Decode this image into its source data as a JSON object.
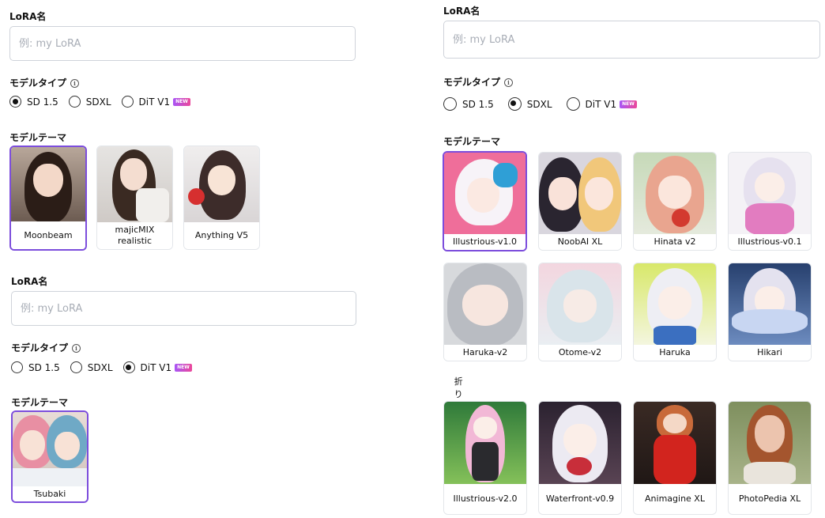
{
  "colors": {
    "accent": "#7c4ddc",
    "new_badge": "#c026d3"
  },
  "panels": [
    {
      "lora_label": "LoRA名",
      "placeholder": "例: my LoRA",
      "type_label": "モデルタイプ",
      "radios": [
        {
          "label": "SD 1.5",
          "selected": true,
          "new": false
        },
        {
          "label": "SDXL",
          "selected": false,
          "new": false
        },
        {
          "label": "DiT V1",
          "selected": false,
          "new": true
        }
      ],
      "theme_label": "モデルテーマ",
      "themes": [
        {
          "name": "Moonbeam",
          "selected": true
        },
        {
          "name": "majicMIX realistic",
          "selected": false
        },
        {
          "name": "Anything V5",
          "selected": false
        }
      ]
    },
    {
      "lora_label": "LoRA名",
      "placeholder": "例: my LoRA",
      "type_label": "モデルタイプ",
      "radios": [
        {
          "label": "SD 1.5",
          "selected": false,
          "new": false
        },
        {
          "label": "SDXL",
          "selected": false,
          "new": false
        },
        {
          "label": "DiT V1",
          "selected": true,
          "new": true
        }
      ],
      "theme_label": "モデルテーマ",
      "themes": [
        {
          "name": "Tsubaki",
          "selected": true
        }
      ]
    },
    {
      "lora_label": "LoRA名",
      "placeholder": "例: my LoRA",
      "type_label": "モデルタイプ",
      "radios": [
        {
          "label": "SD 1.5",
          "selected": false,
          "new": false
        },
        {
          "label": "SDXL",
          "selected": true,
          "new": false
        },
        {
          "label": "DiT V1",
          "selected": false,
          "new": true
        }
      ],
      "theme_label": "モデルテーマ",
      "themes": [
        {
          "name": "Illustrious-v1.0",
          "selected": true
        },
        {
          "name": "NoobAI XL",
          "selected": false
        },
        {
          "name": "Hinata v2",
          "selected": false
        },
        {
          "name": "Illustrious-v0.1",
          "selected": false
        },
        {
          "name": "Haruka-v2",
          "selected": false
        },
        {
          "name": "Otome-v2",
          "selected": false
        },
        {
          "name": "Haruka",
          "selected": false
        },
        {
          "name": "Hikari",
          "selected": false
        }
      ],
      "collapse_label": "折りたたむ",
      "more_themes": [
        {
          "name": "Illustrious-v2.0",
          "selected": false
        },
        {
          "name": "Waterfront-v0.9",
          "selected": false
        },
        {
          "name": "Animagine XL",
          "selected": false
        },
        {
          "name": "PhotoPedia XL",
          "selected": false
        }
      ]
    }
  ],
  "new_badge": "NEW"
}
